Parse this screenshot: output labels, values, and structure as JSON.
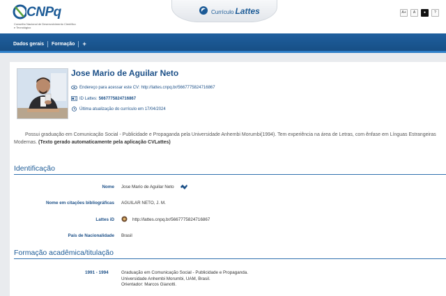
{
  "header": {
    "logo_text": "CNPq",
    "logo_subtitle": "Conselho Nacional de Desenvolvimento Científico e Tecnológico",
    "brand_prefix": "Currículo",
    "brand_name": "Lattes",
    "accessibility": [
      "A+",
      "A",
      "●",
      "?"
    ]
  },
  "nav": {
    "items": [
      "Dados gerais",
      "Formação"
    ],
    "more": "+"
  },
  "profile": {
    "name": "Jose Mario de Aguilar Neto",
    "cv_address_label": "Endereço para acessar este CV:",
    "cv_address_url": "http://lattes.cnpq.br/5667775824716867",
    "lattes_id_label": "ID Lattes:",
    "lattes_id": "5667775824716867",
    "last_update": "Última atualização do currículo em 17/04/2024"
  },
  "resume": {
    "text": "Possui graduação em Comunicação Social - Publicidade e Propaganda pela Universidade Anhembi Morumbi(1994). Tem experiência na área de Letras, com ênfase em Línguas Estrangeiras Modernas.",
    "note": "(Texto gerado automaticamente pela aplicação CVLattes)"
  },
  "identification": {
    "title": "Identificação",
    "name_label": "Nome",
    "name_value": "Jose Mario de Aguilar Neto",
    "citation_label": "Nome em citações bibliográficas",
    "citation_value": "AGUILAR NETO, J. M.",
    "lattes_label": "Lattes iD",
    "lattes_value": "http://lattes.cnpq.br/5667775824716867",
    "country_label": "País de Nacionalidade",
    "country_value": "Brasil"
  },
  "education": {
    "title": "Formação acadêmica/titulação",
    "years": "1991 - 1994",
    "line1": "Graduação em Comunicação Social - Publicidade e Propaganda.",
    "line2": "Universidade Anhembi Morumbi, UAM, Brasil.",
    "line3": "Orientador: Marcos Gianotti."
  },
  "colors": {
    "nav_bg": "#1f5f9e",
    "accent": "#1b5a96",
    "page_bg": "#e9ebee"
  }
}
